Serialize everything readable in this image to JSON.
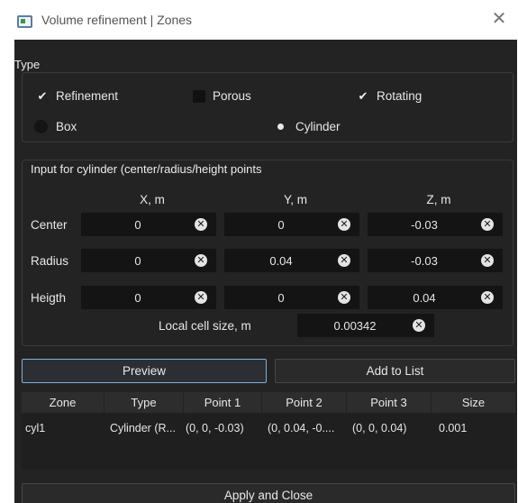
{
  "window": {
    "title": "Volume refinement | Zones",
    "close_glyph": "✕"
  },
  "type_section": {
    "title": "Type",
    "checkboxes": [
      {
        "label": "Refinement",
        "checked": true
      },
      {
        "label": "Porous",
        "checked": false
      },
      {
        "label": "Rotating",
        "checked": true
      }
    ],
    "radios": [
      {
        "label": "Box",
        "selected": false
      },
      {
        "label": "Cylinder",
        "selected": true
      }
    ]
  },
  "input_section": {
    "title": "Input for cylinder (center/radius/height points",
    "columns": [
      "X, m",
      "Y, m",
      "Z, m"
    ],
    "rows": [
      {
        "label": "Center",
        "values": [
          "0",
          "0",
          "-0.03"
        ]
      },
      {
        "label": "Radius",
        "values": [
          "0",
          "0.04",
          "-0.03"
        ]
      },
      {
        "label": "Heigth",
        "values": [
          "0",
          "0",
          "0.04"
        ]
      }
    ],
    "cell_size_label": "Local cell size, m",
    "cell_size_value": "0.00342"
  },
  "buttons": {
    "preview": "Preview",
    "add_to_list": "Add to List",
    "apply_close": "Apply and Close"
  },
  "table": {
    "headers": [
      "Zone",
      "Type",
      "Point 1",
      "Point 2",
      "Point 3",
      "Size"
    ],
    "rows": [
      [
        "cyl1",
        "Cylinder (R...",
        "(0, 0, -0.03)",
        "(0, 0.04, -0....",
        "(0, 0, 0.04)",
        "0.001"
      ]
    ]
  },
  "icons": {
    "check": "check-icon",
    "clear": "clear-circle-x-icon",
    "app": "app-window-icon"
  },
  "colors": {
    "background": "#232323",
    "field": "#141414",
    "focus_border": "#7fb0e0"
  }
}
